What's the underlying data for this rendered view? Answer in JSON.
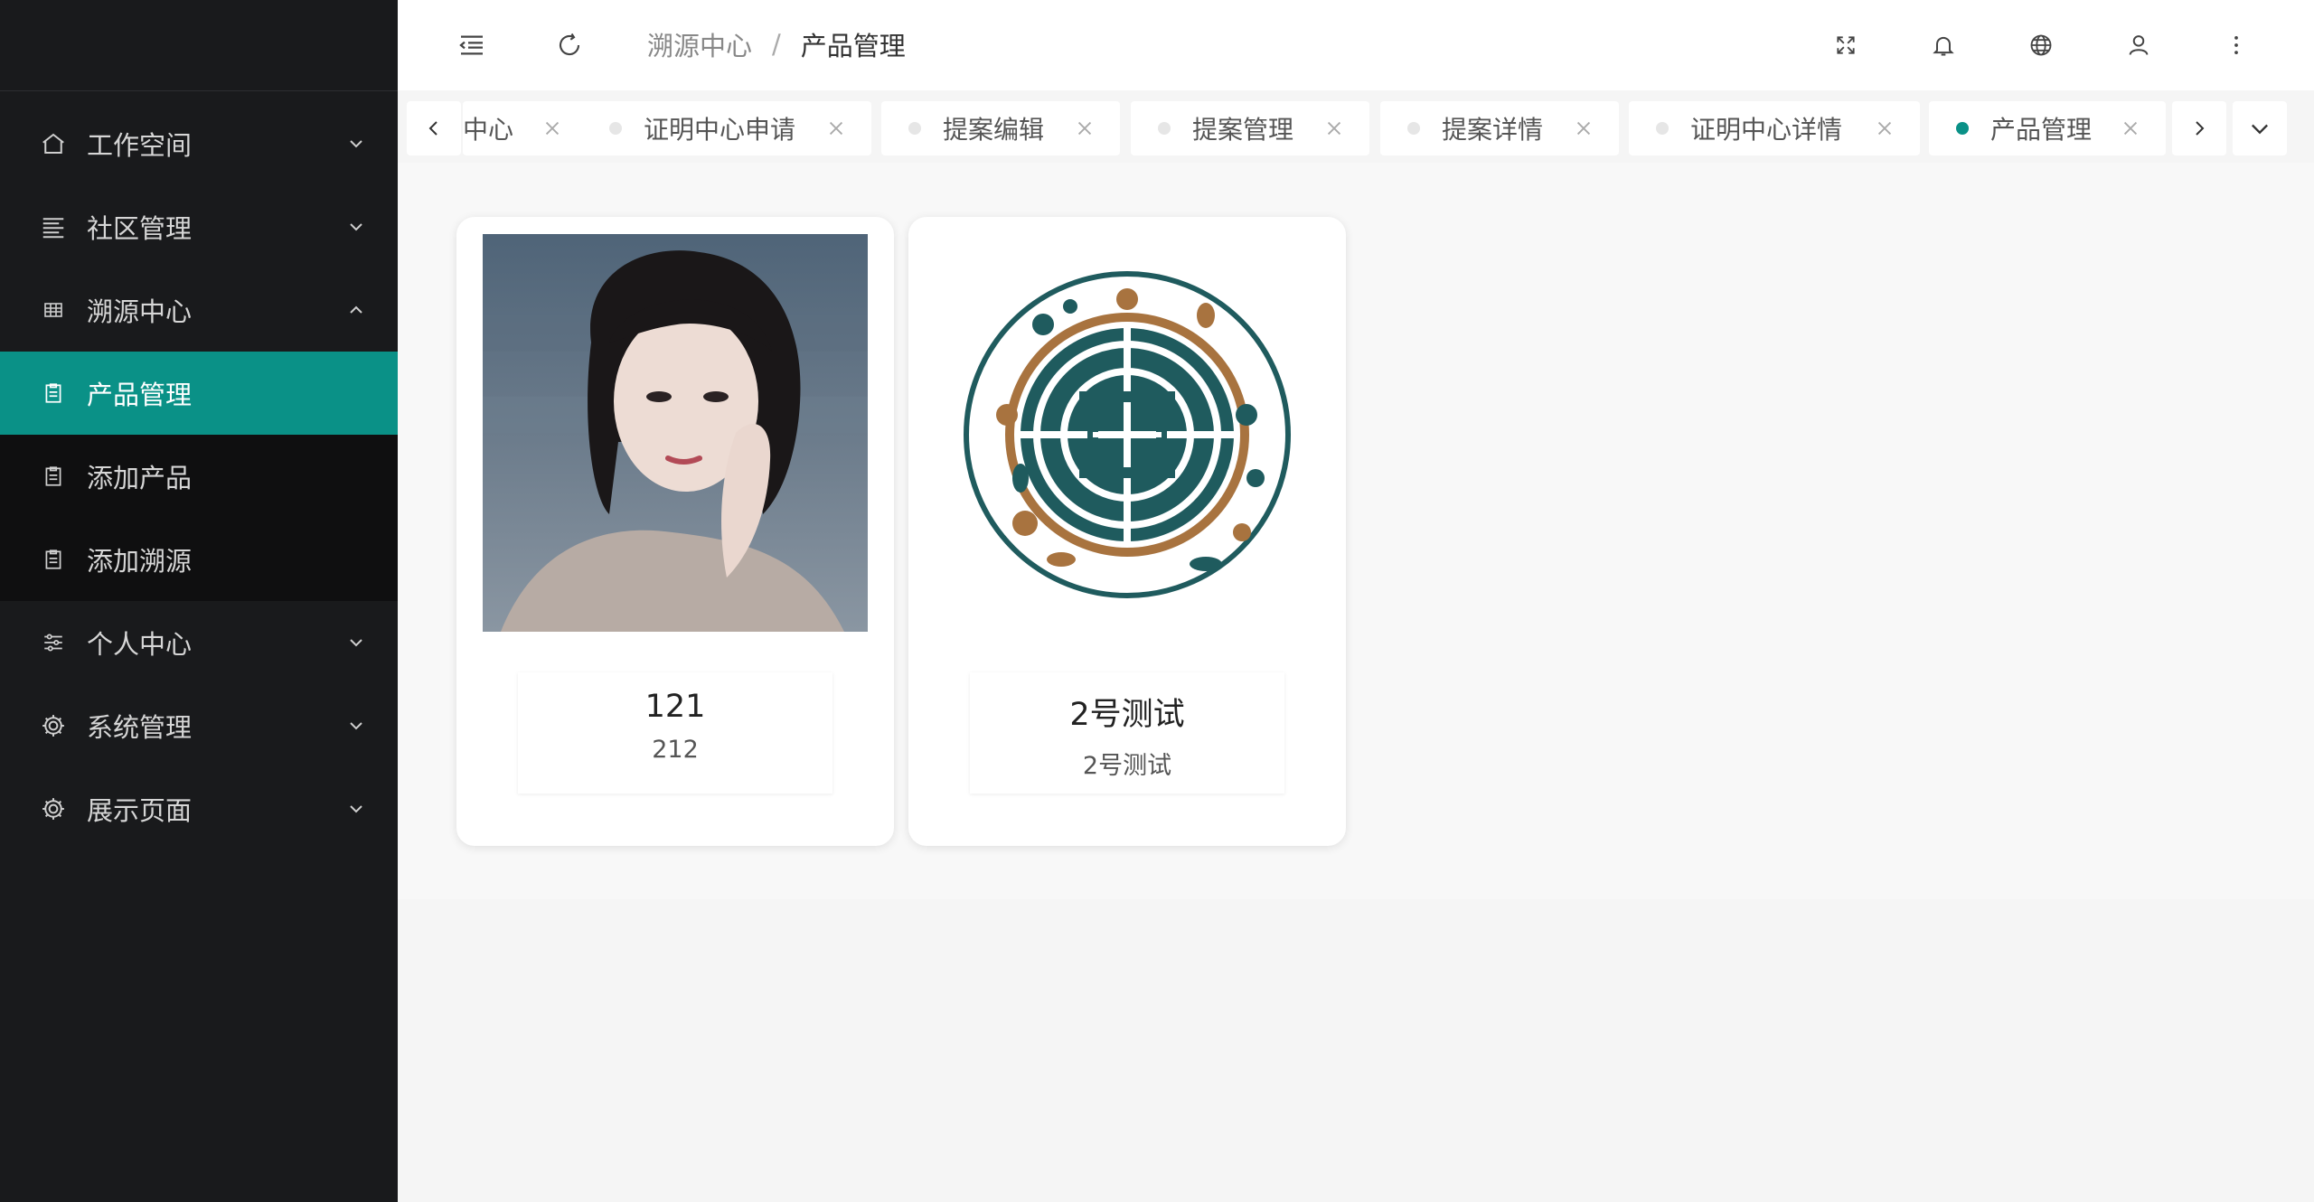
{
  "sidebar": {
    "items": [
      {
        "label": "工作空间",
        "icon": "home-icon",
        "expanded": false
      },
      {
        "label": "社区管理",
        "icon": "list-icon",
        "expanded": false
      },
      {
        "label": "溯源中心",
        "icon": "grid-icon",
        "expanded": true,
        "children": [
          {
            "label": "产品管理",
            "icon": "clipboard-icon",
            "active": true
          },
          {
            "label": "添加产品",
            "icon": "clipboard-icon"
          },
          {
            "label": "添加溯源",
            "icon": "clipboard-icon"
          }
        ]
      },
      {
        "label": "个人中心",
        "icon": "sliders-icon",
        "expanded": false
      },
      {
        "label": "系统管理",
        "icon": "gear-icon",
        "expanded": false
      },
      {
        "label": "展示页面",
        "icon": "gear-icon",
        "expanded": false
      }
    ]
  },
  "header": {
    "breadcrumb": [
      "溯源中心",
      "产品管理"
    ],
    "separator": "/"
  },
  "tabs": [
    {
      "label": "中心",
      "active": false
    },
    {
      "label": "证明中心申请",
      "active": false
    },
    {
      "label": "提案编辑",
      "active": false
    },
    {
      "label": "提案管理",
      "active": false
    },
    {
      "label": "提案详情",
      "active": false
    },
    {
      "label": "证明中心详情",
      "active": false
    },
    {
      "label": "产品管理",
      "active": true
    }
  ],
  "products": [
    {
      "title": "121",
      "subtitle": "212",
      "image": "portrait-photo"
    },
    {
      "title": "2号测试",
      "subtitle": "2号测试",
      "image": "emblem-logo"
    }
  ],
  "colors": {
    "accent": "#0a9187",
    "sidebar_bg": "#191a1c",
    "emblem_teal": "#1f5b5e",
    "emblem_brown": "#a8733f"
  }
}
